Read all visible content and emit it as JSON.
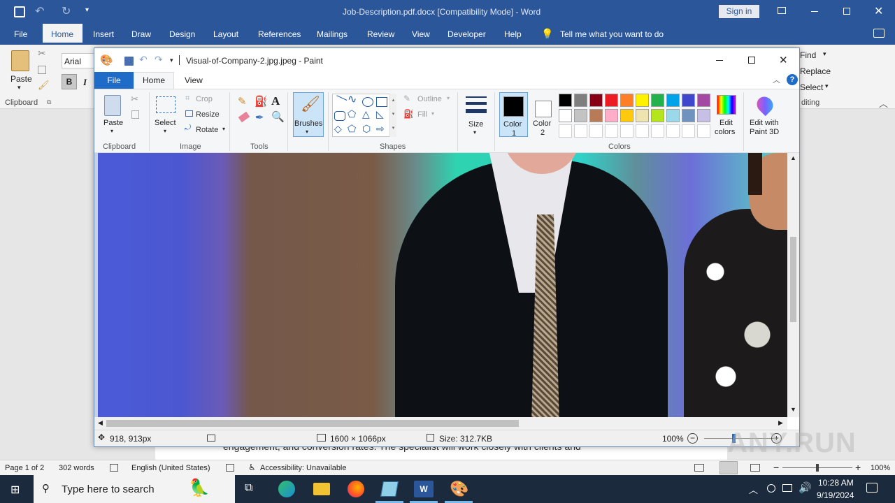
{
  "word": {
    "title": "Job-Description.pdf.docx [Compatibility Mode]  -  Word",
    "sign_in": "Sign in",
    "tabs": [
      "File",
      "Home",
      "Insert",
      "Draw",
      "Design",
      "Layout",
      "References",
      "Mailings",
      "Review",
      "View",
      "Developer",
      "Help"
    ],
    "tell_me": "Tell me what you want to do",
    "font_name": "Arial",
    "paste_label": "Paste",
    "clipboard_label": "Clipboard",
    "bold": "B",
    "italic": "I",
    "find": "Find",
    "replace": "Replace",
    "select": "Select",
    "editing": "diting",
    "body_fragment": "engagement, and conversion rates. The specialist will work closely with clients and",
    "status": {
      "page": "Page 1 of 2",
      "words": "302 words",
      "language": "English (United States)",
      "accessibility": "Accessibility: Unavailable",
      "zoom": "100%"
    }
  },
  "paint": {
    "title": "Visual-of-Company-2.jpg.jpeg - Paint",
    "tabs": [
      "File",
      "Home",
      "View"
    ],
    "clipboard": {
      "paste": "Paste",
      "label": "Clipboard"
    },
    "image": {
      "select": "Select",
      "crop": "Crop",
      "resize": "Resize",
      "rotate": "Rotate",
      "label": "Image"
    },
    "tools_label": "Tools",
    "brushes": "Brushes",
    "shapes": {
      "outline": "Outline",
      "fill": "Fill",
      "label": "Shapes"
    },
    "size": "Size",
    "color1": "Color",
    "color1_num": "1",
    "color2": "Color",
    "color2_num": "2",
    "colors_label": "Colors",
    "edit_colors": [
      "Edit",
      "colors"
    ],
    "edit_3d": [
      "Edit with",
      "Paint 3D"
    ],
    "palette_row1": [
      "#000000",
      "#7f7f7f",
      "#880015",
      "#ed1c24",
      "#ff7f27",
      "#fff200",
      "#22b14c",
      "#00a2e8",
      "#3f48cc",
      "#a349a4"
    ],
    "palette_row2": [
      "#ffffff",
      "#c3c3c3",
      "#b97a57",
      "#ffaec9",
      "#ffc90e",
      "#efe4b0",
      "#b5e61d",
      "#99d9ea",
      "#7092be",
      "#c8bfe7"
    ],
    "status": {
      "cursor": "918, 913px",
      "dimensions": "1600 × 1066px",
      "size": "Size: 312.7KB",
      "zoom": "100%"
    }
  },
  "taskbar": {
    "search_placeholder": "Type here to search",
    "time": "10:28 AM",
    "date": "9/19/2024"
  },
  "watermark": "ANY.RUN"
}
